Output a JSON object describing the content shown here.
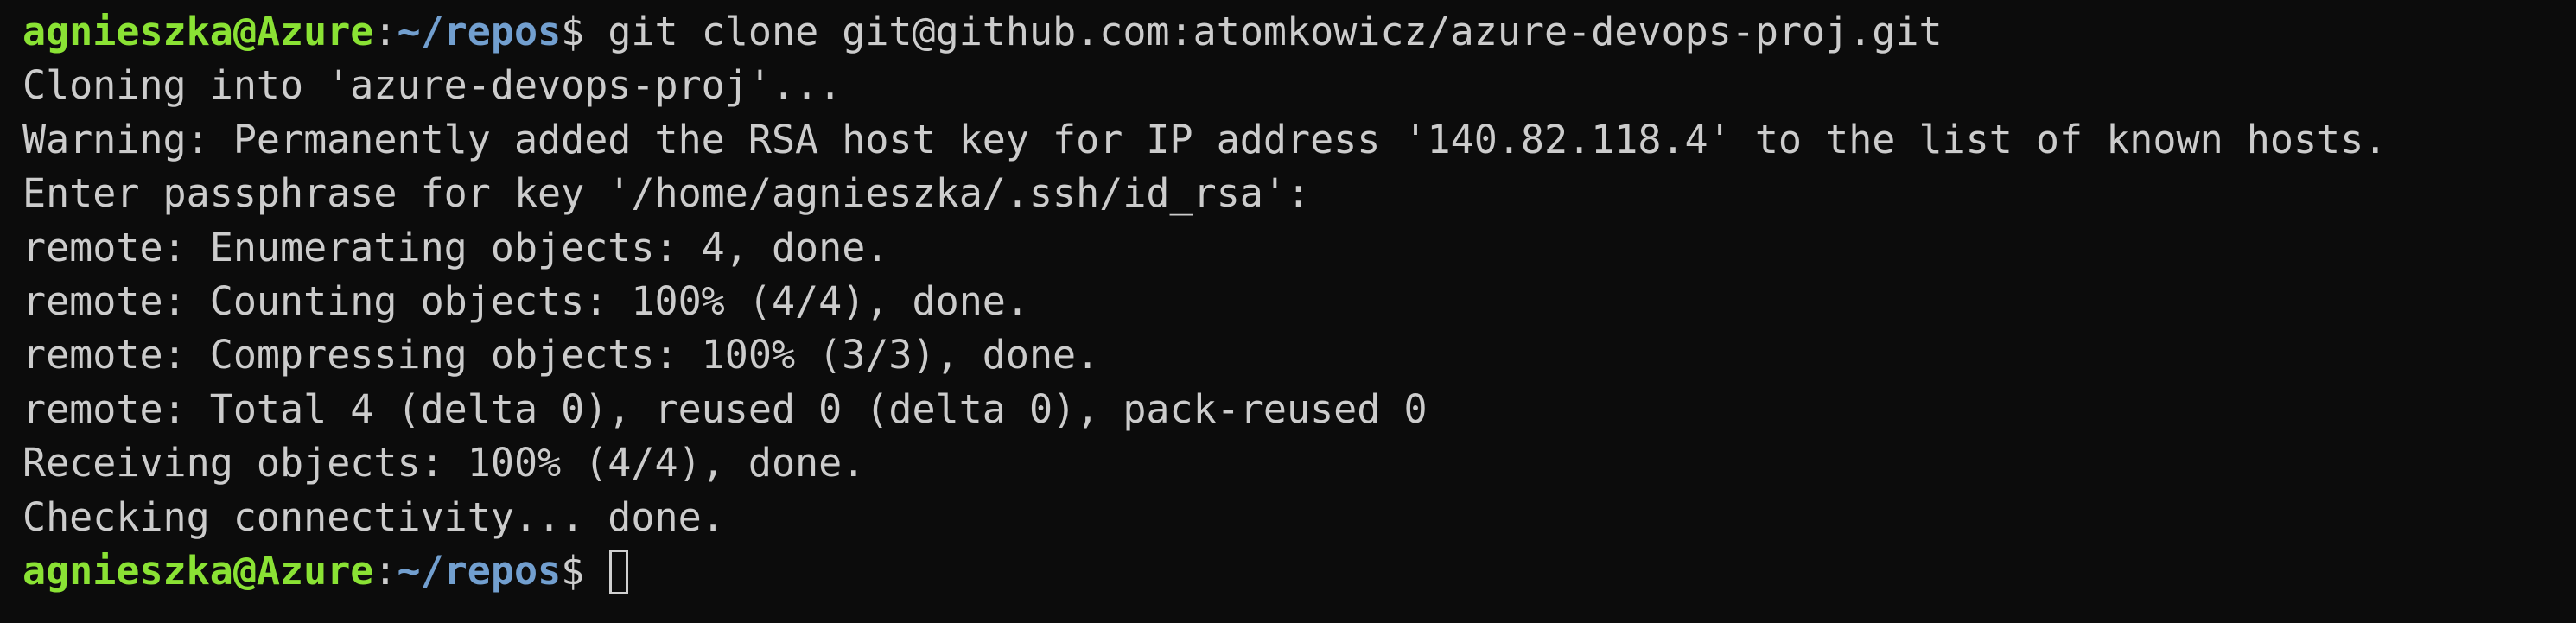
{
  "prompt": {
    "user_host": "agnieszka@Azure",
    "separator": ":",
    "path": "~/repos",
    "symbol": "$ "
  },
  "command": "git clone git@github.com:atomkowicz/azure-devops-proj.git",
  "output_lines": [
    "Cloning into 'azure-devops-proj'...",
    "Warning: Permanently added the RSA host key for IP address '140.82.118.4' to the list of known hosts.",
    "Enter passphrase for key '/home/agnieszka/.ssh/id_rsa':",
    "remote: Enumerating objects: 4, done.",
    "remote: Counting objects: 100% (4/4), done.",
    "remote: Compressing objects: 100% (3/3), done.",
    "remote: Total 4 (delta 0), reused 0 (delta 0), pack-reused 0",
    "Receiving objects: 100% (4/4), done.",
    "Checking connectivity... done."
  ],
  "colors": {
    "background": "#0c0c0c",
    "text": "#cccccc",
    "user_host": "#8ae234",
    "path": "#729fcf"
  }
}
